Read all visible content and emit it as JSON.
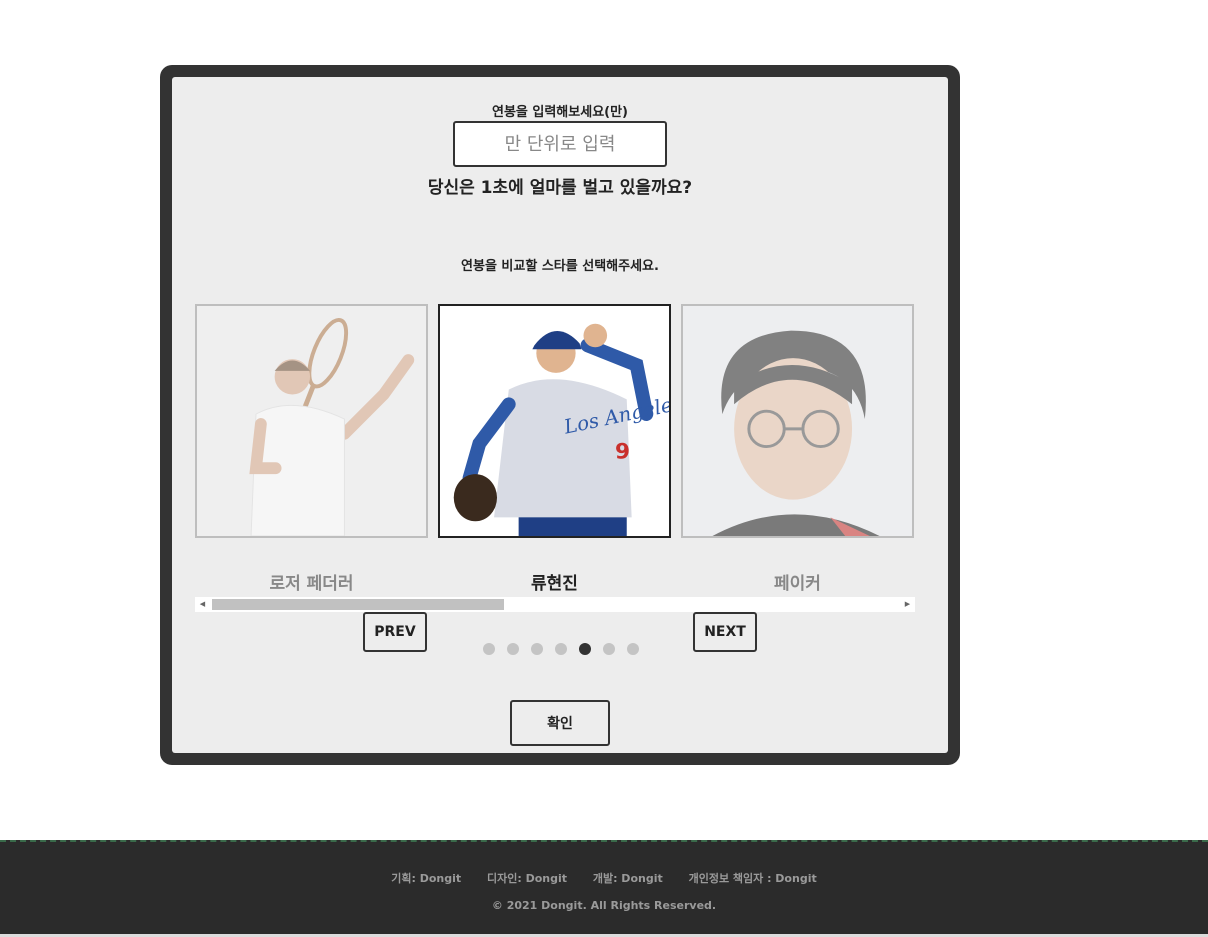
{
  "form": {
    "salary_label": "연봉을 입력해보세요(만)",
    "salary_placeholder": "만 단위로 입력",
    "salary_value": "",
    "question": "당신은 1초에 얼마를 벌고 있을까요?",
    "select_prompt": "연봉을 비교할 스타를 선택해주세요."
  },
  "carousel": {
    "cards": [
      {
        "name": "로저 페더러",
        "icon": "tennis-player-photo",
        "active": false
      },
      {
        "name": "류현진",
        "icon": "baseball-pitcher-photo",
        "active": true
      },
      {
        "name": "페이커",
        "icon": "esports-player-photo",
        "active": false
      }
    ],
    "prev_label": "PREV",
    "next_label": "NEXT",
    "dot_count": 7,
    "active_dot_index": 4,
    "scroll_position_fraction": 0.0,
    "scroll_thumb_fraction": 0.41
  },
  "confirm_label": "확인",
  "footer": {
    "credits": [
      "기획: Dongit",
      "디자인: Dongit",
      "개발: Dongit",
      "개인정보 책임자 : Dongit"
    ],
    "copyright": "© 2021 Dongit. All Rights Reserved."
  },
  "colors": {
    "frame": "#333333",
    "panel": "#ededed",
    "footer": "#2b2b2b",
    "active_dot": "#333333",
    "inactive_dot": "#c4c4c4"
  }
}
